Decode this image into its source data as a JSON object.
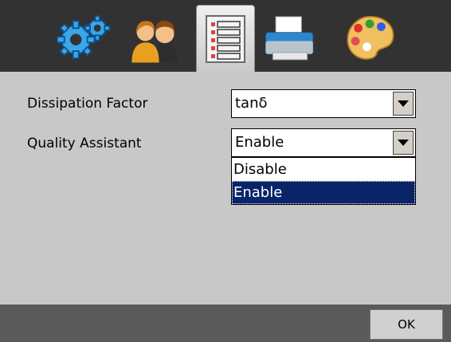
{
  "toolbar": {
    "icons": [
      {
        "name": "settings-gears-icon",
        "active": false
      },
      {
        "name": "users-icon",
        "active": false
      },
      {
        "name": "list-form-icon",
        "active": true
      },
      {
        "name": "printer-icon",
        "active": false
      },
      {
        "name": "palette-icon",
        "active": false
      }
    ]
  },
  "form": {
    "dissipation_factor": {
      "label": "Dissipation Factor",
      "value": "tanδ"
    },
    "quality_assistant": {
      "label": "Quality Assistant",
      "value": "Enable",
      "options": [
        "Disable",
        "Enable"
      ],
      "selected_index": 1
    }
  },
  "footer": {
    "ok_label": "OK"
  },
  "colors": {
    "toolbar_bg": "#323232",
    "panel_bg": "#c8c8c8",
    "footer_bg": "#5a5a5a",
    "selection_bg": "#0a246a"
  }
}
